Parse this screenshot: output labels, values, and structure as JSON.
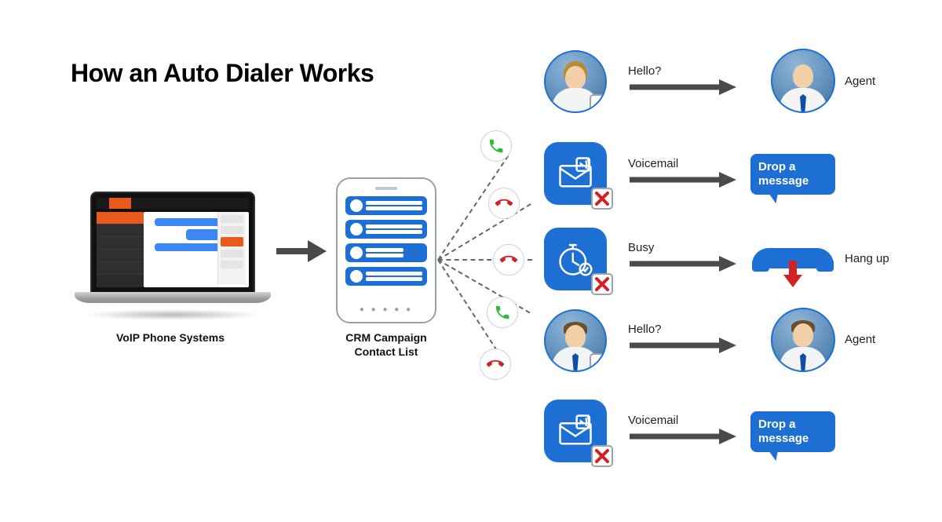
{
  "title": "How an Auto Dialer Works",
  "voip_label": "VoIP Phone Systems",
  "crm_label": "CRM Campaign Contact List",
  "phone_colors": {
    "green": "#2fbb3a",
    "red": "#d32020"
  },
  "outcomes": [
    {
      "label": "Hello?",
      "type": "person",
      "status": "ok",
      "result_kind": "agent",
      "result_label": "Agent",
      "phone": "green"
    },
    {
      "label": "Voicemail",
      "type": "voicemail",
      "status": "fail",
      "result_kind": "message",
      "result_label": "Drop a message",
      "phone": "red"
    },
    {
      "label": "Busy",
      "type": "busy",
      "status": "fail",
      "result_kind": "hangup",
      "result_label": "Hang up",
      "phone": "red"
    },
    {
      "label": "Hello?",
      "type": "person",
      "status": "ok",
      "result_kind": "agent",
      "result_label": "Agent",
      "phone": "green"
    },
    {
      "label": "Voicemail",
      "type": "voicemail",
      "status": "fail",
      "result_kind": "message",
      "result_label": "Drop a message",
      "phone": "red"
    }
  ]
}
